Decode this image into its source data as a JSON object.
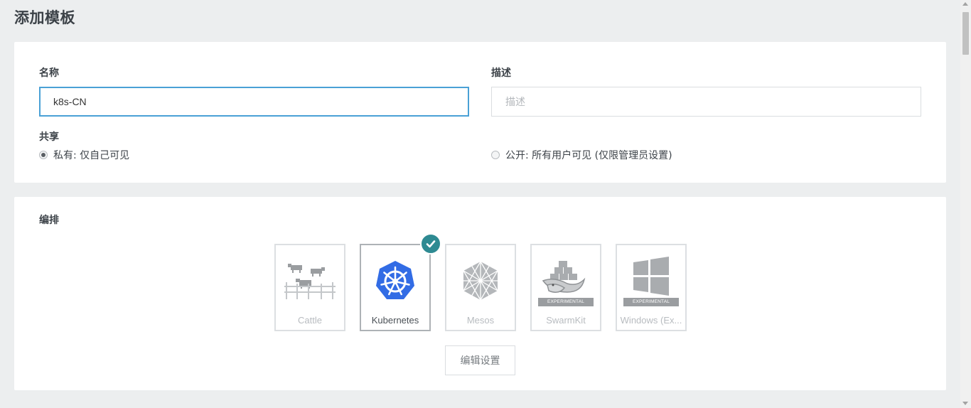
{
  "page": {
    "title": "添加模板"
  },
  "form": {
    "name_label": "名称",
    "name_value": "k8s-CN",
    "description_label": "描述",
    "description_placeholder": "描述",
    "share_label": "共享",
    "share_options": [
      {
        "label": "私有: 仅自己可见",
        "checked": true
      },
      {
        "label": "公开: 所有用户可见 (仅限管理员设置)",
        "checked": false
      }
    ]
  },
  "orchestration": {
    "section_label": "编排",
    "drivers": [
      {
        "name": "Cattle",
        "icon": "cattle-icon",
        "selected": false,
        "experimental": false
      },
      {
        "name": "Kubernetes",
        "icon": "kubernetes-icon",
        "selected": true,
        "experimental": false
      },
      {
        "name": "Mesos",
        "icon": "mesos-icon",
        "selected": false,
        "experimental": false
      },
      {
        "name": "SwarmKit",
        "icon": "swarmkit-icon",
        "selected": false,
        "experimental": true
      },
      {
        "name": "Windows (Ex...",
        "icon": "windows-icon",
        "selected": false,
        "experimental": true
      }
    ],
    "experimental_tag": "EXPERIMENTAL",
    "edit_button": "编辑设置"
  },
  "colors": {
    "accent": "#4aa1d6",
    "check_badge": "#2e8a92",
    "kubernetes_blue": "#326ce5",
    "background": "#eceeef"
  }
}
